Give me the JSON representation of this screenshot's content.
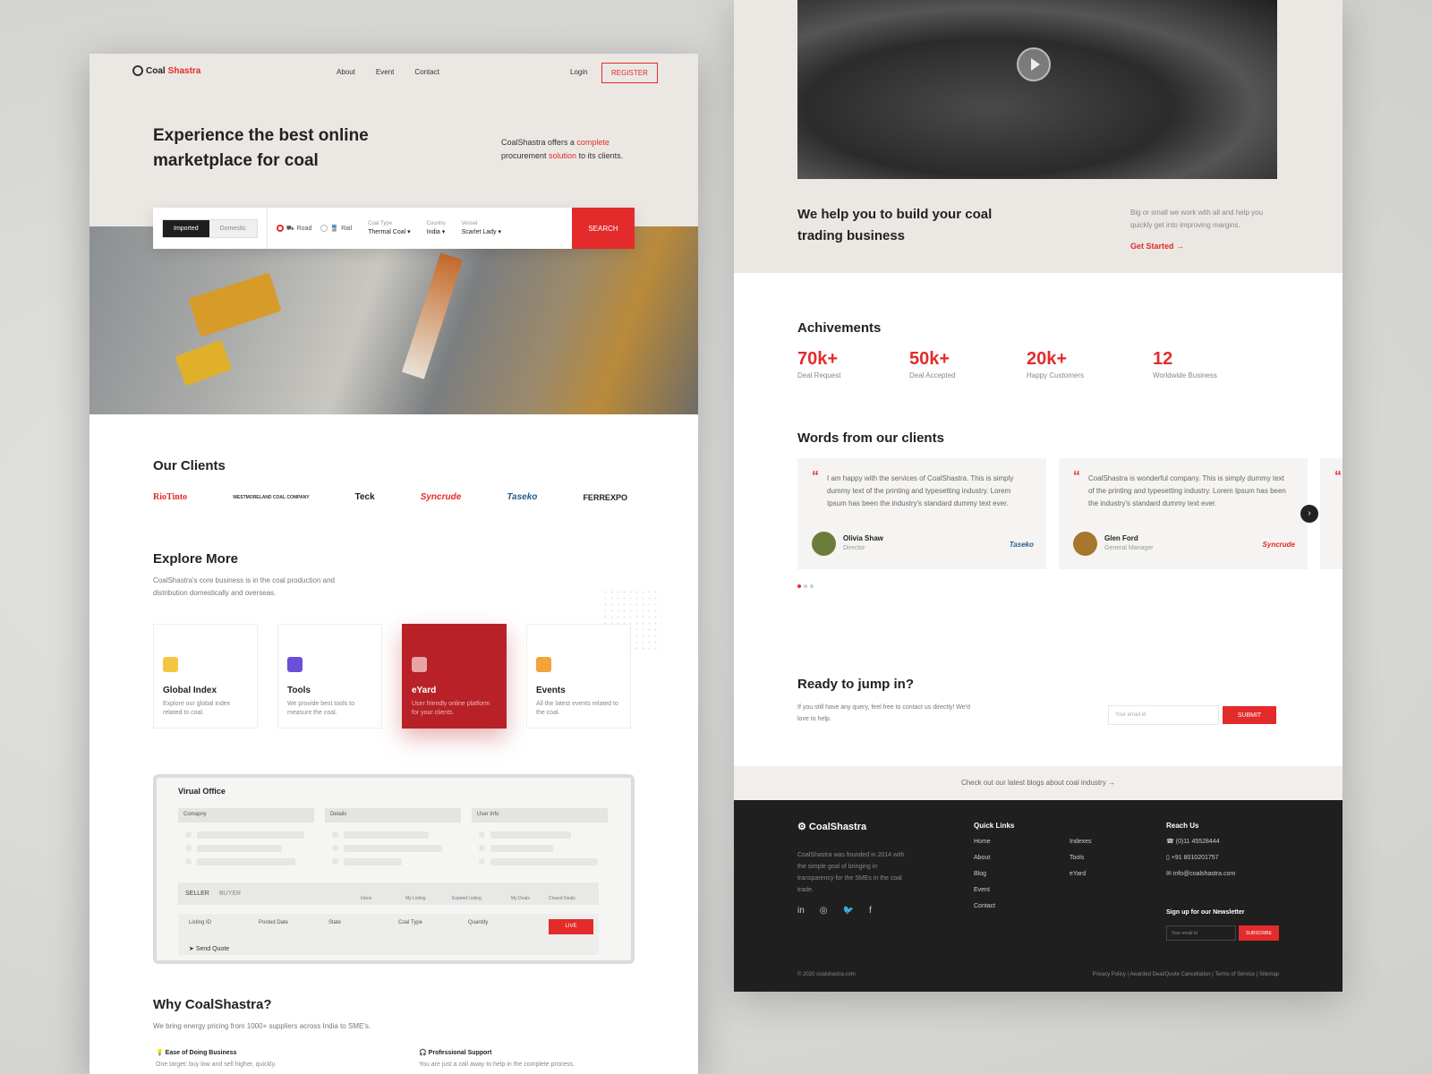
{
  "colors": {
    "accent": "#e32b2b",
    "dark": "#1f1f1f",
    "beige": "#ebe8e4",
    "card_red": "#b82128"
  },
  "nav": {
    "logo_a": "Coal",
    "logo_b": "Shastra",
    "links": [
      "About",
      "Event",
      "Contact"
    ],
    "login": "Login",
    "register": "REGISTER"
  },
  "hero": {
    "title": "Experience the best online marketplace for coal",
    "desc_1": "CoalShastra offers a ",
    "desc_2": "complete",
    "desc_3": " procurement ",
    "desc_4": "solution",
    "desc_5": " to its clients."
  },
  "search": {
    "tab_imported": "Imported",
    "tab_domestic": "Domestic",
    "road": "Road",
    "rail": "Rail",
    "coal_type_label": "Coal Type",
    "coal_type": "Thermal Coal ▾",
    "country_label": "Country",
    "country": "India ▾",
    "vessel_label": "Vessel",
    "vessel": "Scarlet Lady ▾",
    "button": "SEARCH"
  },
  "clients": {
    "title": "Our Clients",
    "logos": [
      "RioTinto",
      "WESTMORELAND COAL COMPANY",
      "Teck",
      "Syncrude",
      "Taseko",
      "FERREXPO"
    ]
  },
  "explore": {
    "title": "Explore More",
    "desc": "CoalShastra's core business is in the coal production and distribution domestically and overseas.",
    "cards": [
      {
        "title": "Global Index",
        "desc": "Explore our global index related to coal."
      },
      {
        "title": "Tools",
        "desc": "We provide best tools to measure the coal."
      },
      {
        "title": "eYard",
        "desc": "User friendly online platform for your clients."
      },
      {
        "title": "Events",
        "desc": "All the latest events related to the coal."
      }
    ]
  },
  "office": {
    "title": "Virual Office",
    "cols": [
      "Comapny",
      "Details",
      "User Info"
    ],
    "seller": "SELLER",
    "buyer": "BUYER",
    "stats": [
      "Inbox",
      "My Listing",
      "Expired Listing",
      "My Deals",
      "Closed Deals"
    ],
    "fields": [
      "Listing ID",
      "Posted Date",
      "State",
      "Coal Type",
      "Quantity"
    ],
    "live": "LIVE",
    "send_quote": "Send Quote"
  },
  "why": {
    "title": "Why CoalShastra?",
    "desc": "We bring energy pricing from 1000+ suppliers across India to SME's.",
    "f1": "Ease of Doing Business",
    "f1d": "One target: buy low and sell higher, quickly.",
    "f2": "Professional Support",
    "f2d": "You are just a call away to help in the complete process."
  },
  "help": {
    "title": "We help you to build your coal trading business",
    "desc": "Big or small we work with all and help you quickly get into improving margins.",
    "cta": "Get Started →"
  },
  "achievements": {
    "title": "Achivements",
    "items": [
      {
        "v": "70k+",
        "l": "Deal Request"
      },
      {
        "v": "50k+",
        "l": "Deal Accepted"
      },
      {
        "v": "20k+",
        "l": "Happy Customers"
      },
      {
        "v": "12",
        "l": "Worldwide Business"
      }
    ]
  },
  "testimonials": {
    "title": "Words from our clients",
    "items": [
      {
        "text": "I am happy with the services of CoalShastra. This is simply dummy text of the printing and typesetting industry. Lorem Ipsum has been the industry's standard dummy text ever.",
        "name": "Olivia Shaw",
        "role": "Director",
        "brand": "Taseko"
      },
      {
        "text": "CoalShastra is wonderful company. This is simply dummy text of the printing and typesetting industry. Lorem Ipsum has been the industry's standard dummy text ever.",
        "name": "Glen Ford",
        "role": "General Manager",
        "brand": "Syncrude"
      }
    ]
  },
  "cta": {
    "title": "Ready to jump in?",
    "desc": "If you still have any query, feel free to contact us directly! We'd love to help.",
    "placeholder": "Your email id",
    "submit": "SUBMIT"
  },
  "blog": "Check out our latest blogs about coal industry  →",
  "footer": {
    "logo": "CoalShastra",
    "desc": "CoalShastra was founded in 2014 with the simple goal of bringing in transparency for the SMEs in the coal trade.",
    "quick": "Quick Links",
    "links1": [
      "Home",
      "About",
      "Blog",
      "Event",
      "Contact"
    ],
    "links2": [
      "Indexes",
      "Tools",
      "eYard"
    ],
    "reach": "Reach Us",
    "phone1": "(0)11 45528444",
    "phone2": "+91 8010201757",
    "email": "info@coalshastra.com",
    "newsletter": "Sign up for our Newsletter",
    "nl_placeholder": "Your email id",
    "nl_btn": "SUBSCRIBE",
    "copy": "© 2020 coalshastra.com",
    "legal": "Privacy Policy | Awarded Deal/Quote Cancellation | Terms of Service | Sitemap"
  }
}
